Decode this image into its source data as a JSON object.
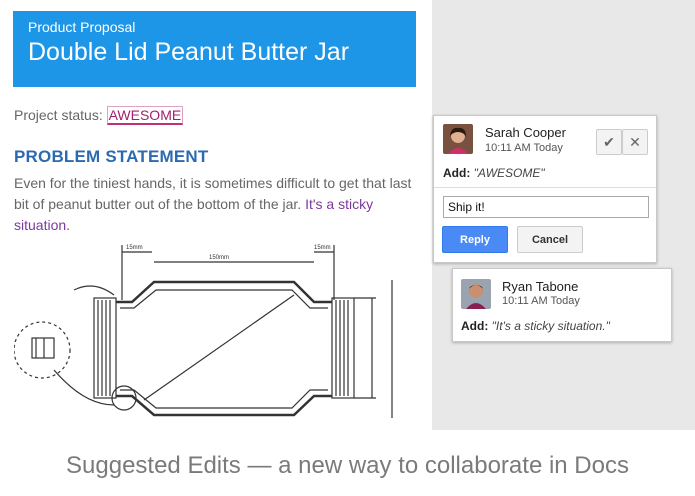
{
  "document": {
    "subtitle": "Product Proposal",
    "title": "Double Lid Peanut Butter Jar",
    "status_label": "Project status:",
    "status_value": "AWESOME",
    "section_heading": "PROBLEM STATEMENT",
    "paragraph": "Even for the tiniest hands, it is sometimes difficult to get that last bit of peanut butter out of the bottom of the jar.",
    "suggested_sentence": "It's a sticky situation."
  },
  "comments": [
    {
      "author": "Sarah Cooper",
      "time": "10:11 AM Today",
      "add_label": "Add:",
      "suggestion": "\"AWESOME\"",
      "reply_value": "Ship it!",
      "reply_button": "Reply",
      "cancel_button": "Cancel",
      "accept_icon": "check-icon",
      "reject_icon": "close-icon"
    },
    {
      "author": "Ryan Tabone",
      "time": "10:11 AM Today",
      "add_label": "Add:",
      "suggestion": "\"It's a sticky situation.\""
    }
  ],
  "caption": "Suggested Edits — a new way to collaborate in Docs",
  "colors": {
    "banner": "#1e96e8",
    "heading": "#2b6ab0",
    "suggestion": "#7a3a9a",
    "reply_button": "#4a8af4",
    "panel": "#e8e8e8"
  }
}
